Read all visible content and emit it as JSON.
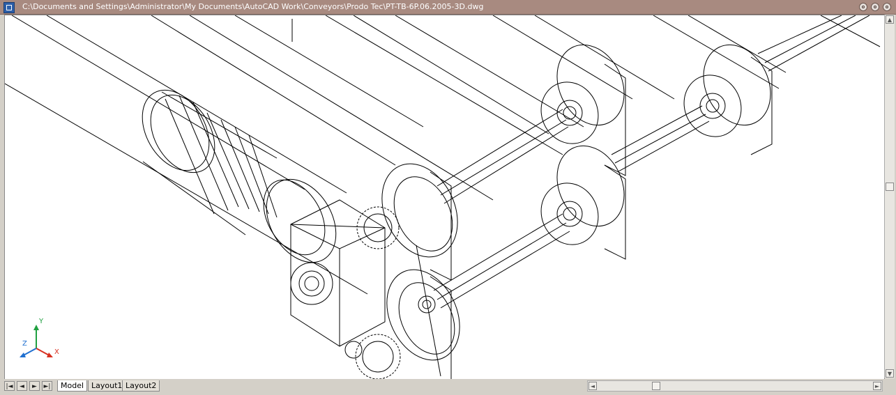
{
  "window": {
    "title": "C:\\Documents and Settings\\Administrator\\My Documents\\AutoCAD Work\\Conveyors\\Prodo Tec\\PT-TB-6P.06.2005-3D.dwg"
  },
  "navigation": {
    "first": "|◄",
    "prev": "◄",
    "next": "►",
    "last": "►|"
  },
  "tabs": [
    "Model",
    "Layout1",
    "Layout2"
  ],
  "active_tab": "Model",
  "ucs": {
    "x": "X",
    "y": "Y",
    "z": "Z"
  },
  "colors": {
    "titlebar": "#a88a80",
    "ucs_x": "#d83020",
    "ucs_y": "#20a040",
    "ucs_z": "#2070d0"
  }
}
